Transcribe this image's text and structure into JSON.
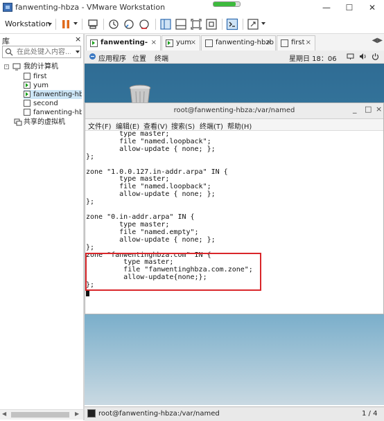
{
  "window": {
    "title": "fanwenting-hbza - VMware Workstation",
    "progress": 0.85,
    "minimize": "—",
    "maximize": "☐",
    "close": "✕"
  },
  "toolbar": {
    "workstation_label": "Workstation"
  },
  "library": {
    "title": "库",
    "close": "×",
    "search_placeholder": "在此处键入内容...",
    "tree": {
      "root_label": "我的计算机",
      "items": [
        {
          "label": "first",
          "running": false
        },
        {
          "label": "yum",
          "running": true
        },
        {
          "label": "fanwenting-hbz",
          "running": true,
          "selected": true
        },
        {
          "label": "second",
          "running": false
        },
        {
          "label": "fanwenting-hbz",
          "running": false
        }
      ],
      "shared_label": "共享的虚拟机"
    }
  },
  "tabs": [
    {
      "label": "fanwenting-hbza",
      "active": true,
      "running": true
    },
    {
      "label": "yum",
      "active": false,
      "running": true
    },
    {
      "label": "fanwenting-hbzb",
      "active": false,
      "running": false
    },
    {
      "label": "first",
      "active": false,
      "running": false
    }
  ],
  "tab_close": "×",
  "tab_scroll": "◀▶",
  "guest_panel": {
    "apps": "应用程序",
    "places": "位置",
    "terminal": "终端",
    "clock": "星期日 18：06"
  },
  "terminal": {
    "title": "root@fanwenting-hbza:/var/named",
    "min": "_",
    "max": "□",
    "close": "×",
    "menu": [
      "文件(F)",
      "编辑(E)",
      "查看(V)",
      "搜索(S)",
      "终端(T)",
      "帮助(H)"
    ],
    "content": "        type master;\n        file \"named.loopback\";\n        allow-update { none; };\n};\n\nzone \"1.0.0.127.in-addr.arpa\" IN {\n        type master;\n        file \"named.loopback\";\n        allow-update { none; };\n};\n\nzone \"0.in-addr.arpa\" IN {\n        type master;\n        file \"named.empty\";\n        allow-update { none; };\n};\nzone \"fanwentinghbza.com\" IN {\n         type master;\n         file \"fanwentinghbza.com.zone\";\n         allow-update{none;};\n};"
  },
  "taskbar": {
    "task": "root@fanwenting-hbza:/var/named",
    "page": "1 / 4"
  }
}
